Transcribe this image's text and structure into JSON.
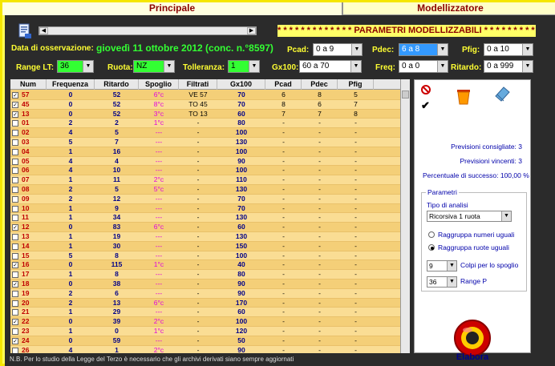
{
  "tabs": {
    "principale": "Principale",
    "modellizzatore": "Modellizzatore"
  },
  "banner": "* * * * * * * * * * * * * PARAMETRI MODELLIZZABILI * * * * * * * * * * * *",
  "observation": {
    "label": "Data di osservazione:",
    "value": "giovedì 11 ottobre 2012 (conc. n.°8597)"
  },
  "filters": {
    "range_lt": {
      "label": "Range LT:",
      "value": "36"
    },
    "ruota": {
      "label": "Ruota:",
      "value": "NZ"
    },
    "tolleranza": {
      "label": "Tolleranza:",
      "value": "1"
    },
    "pcad": {
      "label": "Pcad:",
      "value": "0 a 9"
    },
    "pdec": {
      "label": "Pdec:",
      "value": "6 a 8"
    },
    "pfig": {
      "label": "Pfig:",
      "value": "0 a 10"
    },
    "gx100": {
      "label": "Gx100:",
      "value": "60 a 70"
    },
    "freq": {
      "label": "Freq:",
      "value": "0 a 0"
    },
    "ritardo": {
      "label": "Ritardo:",
      "value": "0 a 999"
    }
  },
  "table": {
    "headers": [
      "Num",
      "Frequenza",
      "Ritardo",
      "Spoglio",
      "Filtrati",
      "Gx100",
      "Pcad",
      "Pdec",
      "Pfig"
    ],
    "rows": [
      {
        "checked": true,
        "num": "57",
        "freq": "0",
        "rit": "52",
        "spo": "6°c",
        "fil": "VE 57",
        "gx": "70",
        "pcad": "6",
        "pdec": "8",
        "pfig": "5"
      },
      {
        "checked": true,
        "num": "45",
        "freq": "0",
        "rit": "52",
        "spo": "8°c",
        "fil": "TO 45",
        "gx": "70",
        "pcad": "8",
        "pdec": "6",
        "pfig": "7"
      },
      {
        "checked": true,
        "num": "13",
        "freq": "0",
        "rit": "52",
        "spo": "3°c",
        "fil": "TO 13",
        "gx": "60",
        "pcad": "7",
        "pdec": "7",
        "pfig": "8"
      },
      {
        "checked": false,
        "num": "01",
        "freq": "2",
        "rit": "2",
        "spo": "1°c",
        "fil": "-",
        "gx": "80",
        "pcad": "-",
        "pdec": "-",
        "pfig": "-"
      },
      {
        "checked": false,
        "num": "02",
        "freq": "4",
        "rit": "5",
        "spo": "---",
        "fil": "-",
        "gx": "100",
        "pcad": "-",
        "pdec": "-",
        "pfig": "-"
      },
      {
        "checked": false,
        "num": "03",
        "freq": "5",
        "rit": "7",
        "spo": "---",
        "fil": "-",
        "gx": "130",
        "pcad": "-",
        "pdec": "-",
        "pfig": "-"
      },
      {
        "checked": false,
        "num": "04",
        "freq": "1",
        "rit": "16",
        "spo": "---",
        "fil": "-",
        "gx": "100",
        "pcad": "-",
        "pdec": "-",
        "pfig": "-"
      },
      {
        "checked": false,
        "num": "05",
        "freq": "4",
        "rit": "4",
        "spo": "---",
        "fil": "-",
        "gx": "90",
        "pcad": "-",
        "pdec": "-",
        "pfig": "-"
      },
      {
        "checked": false,
        "num": "06",
        "freq": "4",
        "rit": "10",
        "spo": "---",
        "fil": "-",
        "gx": "100",
        "pcad": "-",
        "pdec": "-",
        "pfig": "-"
      },
      {
        "checked": false,
        "num": "07",
        "freq": "1",
        "rit": "11",
        "spo": "2°c",
        "fil": "-",
        "gx": "110",
        "pcad": "-",
        "pdec": "-",
        "pfig": "-"
      },
      {
        "checked": false,
        "num": "08",
        "freq": "2",
        "rit": "5",
        "spo": "5°c",
        "fil": "-",
        "gx": "130",
        "pcad": "-",
        "pdec": "-",
        "pfig": "-"
      },
      {
        "checked": false,
        "num": "09",
        "freq": "2",
        "rit": "12",
        "spo": "---",
        "fil": "-",
        "gx": "70",
        "pcad": "-",
        "pdec": "-",
        "pfig": "-"
      },
      {
        "checked": false,
        "num": "10",
        "freq": "1",
        "rit": "9",
        "spo": "---",
        "fil": "-",
        "gx": "70",
        "pcad": "-",
        "pdec": "-",
        "pfig": "-"
      },
      {
        "checked": false,
        "num": "11",
        "freq": "1",
        "rit": "34",
        "spo": "---",
        "fil": "-",
        "gx": "130",
        "pcad": "-",
        "pdec": "-",
        "pfig": "-"
      },
      {
        "checked": true,
        "num": "12",
        "freq": "0",
        "rit": "83",
        "spo": "6°c",
        "fil": "-",
        "gx": "60",
        "pcad": "-",
        "pdec": "-",
        "pfig": "-"
      },
      {
        "checked": false,
        "num": "13",
        "freq": "1",
        "rit": "19",
        "spo": "---",
        "fil": "-",
        "gx": "130",
        "pcad": "-",
        "pdec": "-",
        "pfig": "-"
      },
      {
        "checked": false,
        "num": "14",
        "freq": "1",
        "rit": "30",
        "spo": "---",
        "fil": "-",
        "gx": "150",
        "pcad": "-",
        "pdec": "-",
        "pfig": "-"
      },
      {
        "checked": false,
        "num": "15",
        "freq": "5",
        "rit": "8",
        "spo": "---",
        "fil": "-",
        "gx": "100",
        "pcad": "-",
        "pdec": "-",
        "pfig": "-"
      },
      {
        "checked": true,
        "num": "16",
        "freq": "0",
        "rit": "115",
        "spo": "1°c",
        "fil": "-",
        "gx": "40",
        "pcad": "-",
        "pdec": "-",
        "pfig": "-"
      },
      {
        "checked": false,
        "num": "17",
        "freq": "1",
        "rit": "8",
        "spo": "---",
        "fil": "-",
        "gx": "80",
        "pcad": "-",
        "pdec": "-",
        "pfig": "-"
      },
      {
        "checked": true,
        "num": "18",
        "freq": "0",
        "rit": "38",
        "spo": "---",
        "fil": "-",
        "gx": "90",
        "pcad": "-",
        "pdec": "-",
        "pfig": "-"
      },
      {
        "checked": false,
        "num": "19",
        "freq": "2",
        "rit": "6",
        "spo": "---",
        "fil": "-",
        "gx": "90",
        "pcad": "-",
        "pdec": "-",
        "pfig": "-"
      },
      {
        "checked": false,
        "num": "20",
        "freq": "2",
        "rit": "13",
        "spo": "6°c",
        "fil": "-",
        "gx": "170",
        "pcad": "-",
        "pdec": "-",
        "pfig": "-"
      },
      {
        "checked": false,
        "num": "21",
        "freq": "1",
        "rit": "29",
        "spo": "---",
        "fil": "-",
        "gx": "60",
        "pcad": "-",
        "pdec": "-",
        "pfig": "-"
      },
      {
        "checked": true,
        "num": "22",
        "freq": "0",
        "rit": "39",
        "spo": "2°c",
        "fil": "-",
        "gx": "100",
        "pcad": "-",
        "pdec": "-",
        "pfig": "-"
      },
      {
        "checked": false,
        "num": "23",
        "freq": "1",
        "rit": "0",
        "spo": "1°c",
        "fil": "-",
        "gx": "120",
        "pcad": "-",
        "pdec": "-",
        "pfig": "-"
      },
      {
        "checked": true,
        "num": "24",
        "freq": "0",
        "rit": "59",
        "spo": "---",
        "fil": "-",
        "gx": "50",
        "pcad": "-",
        "pdec": "-",
        "pfig": "-"
      },
      {
        "checked": false,
        "num": "26",
        "freq": "4",
        "rit": "1",
        "spo": "2°c",
        "fil": "-",
        "gx": "90",
        "pcad": "-",
        "pdec": "-",
        "pfig": "-"
      }
    ]
  },
  "right_panel": {
    "previsioni_consigliate": "Previsioni consigliate: 3",
    "previsioni_vincenti": "Previsioni vincenti: 3",
    "percentuale": "Percentuale di successo: 100,00 %",
    "group_title": "Parametri",
    "tipo_label": "Tipo di analisi",
    "tipo_value": "Ricorsiva 1 ruota",
    "radio1": "Raggruppa numeri uguali",
    "radio2": "Raggruppa ruote uguali",
    "colpi_value": "9",
    "colpi_label": "Colpi per lo spoglio",
    "range_p_value": "36",
    "range_p_label": "Range P",
    "elabora": "Elabora"
  },
  "footnote": "N.B. Per lo studio della Legge del Terzo è necessario che gli archivi derivati siano sempre aggiornati",
  "colors": {
    "accent_yellow": "#ffff33",
    "accent_green": "#33ff33",
    "num_red": "#c00000",
    "spoglio_magenta": "#e000e0"
  }
}
